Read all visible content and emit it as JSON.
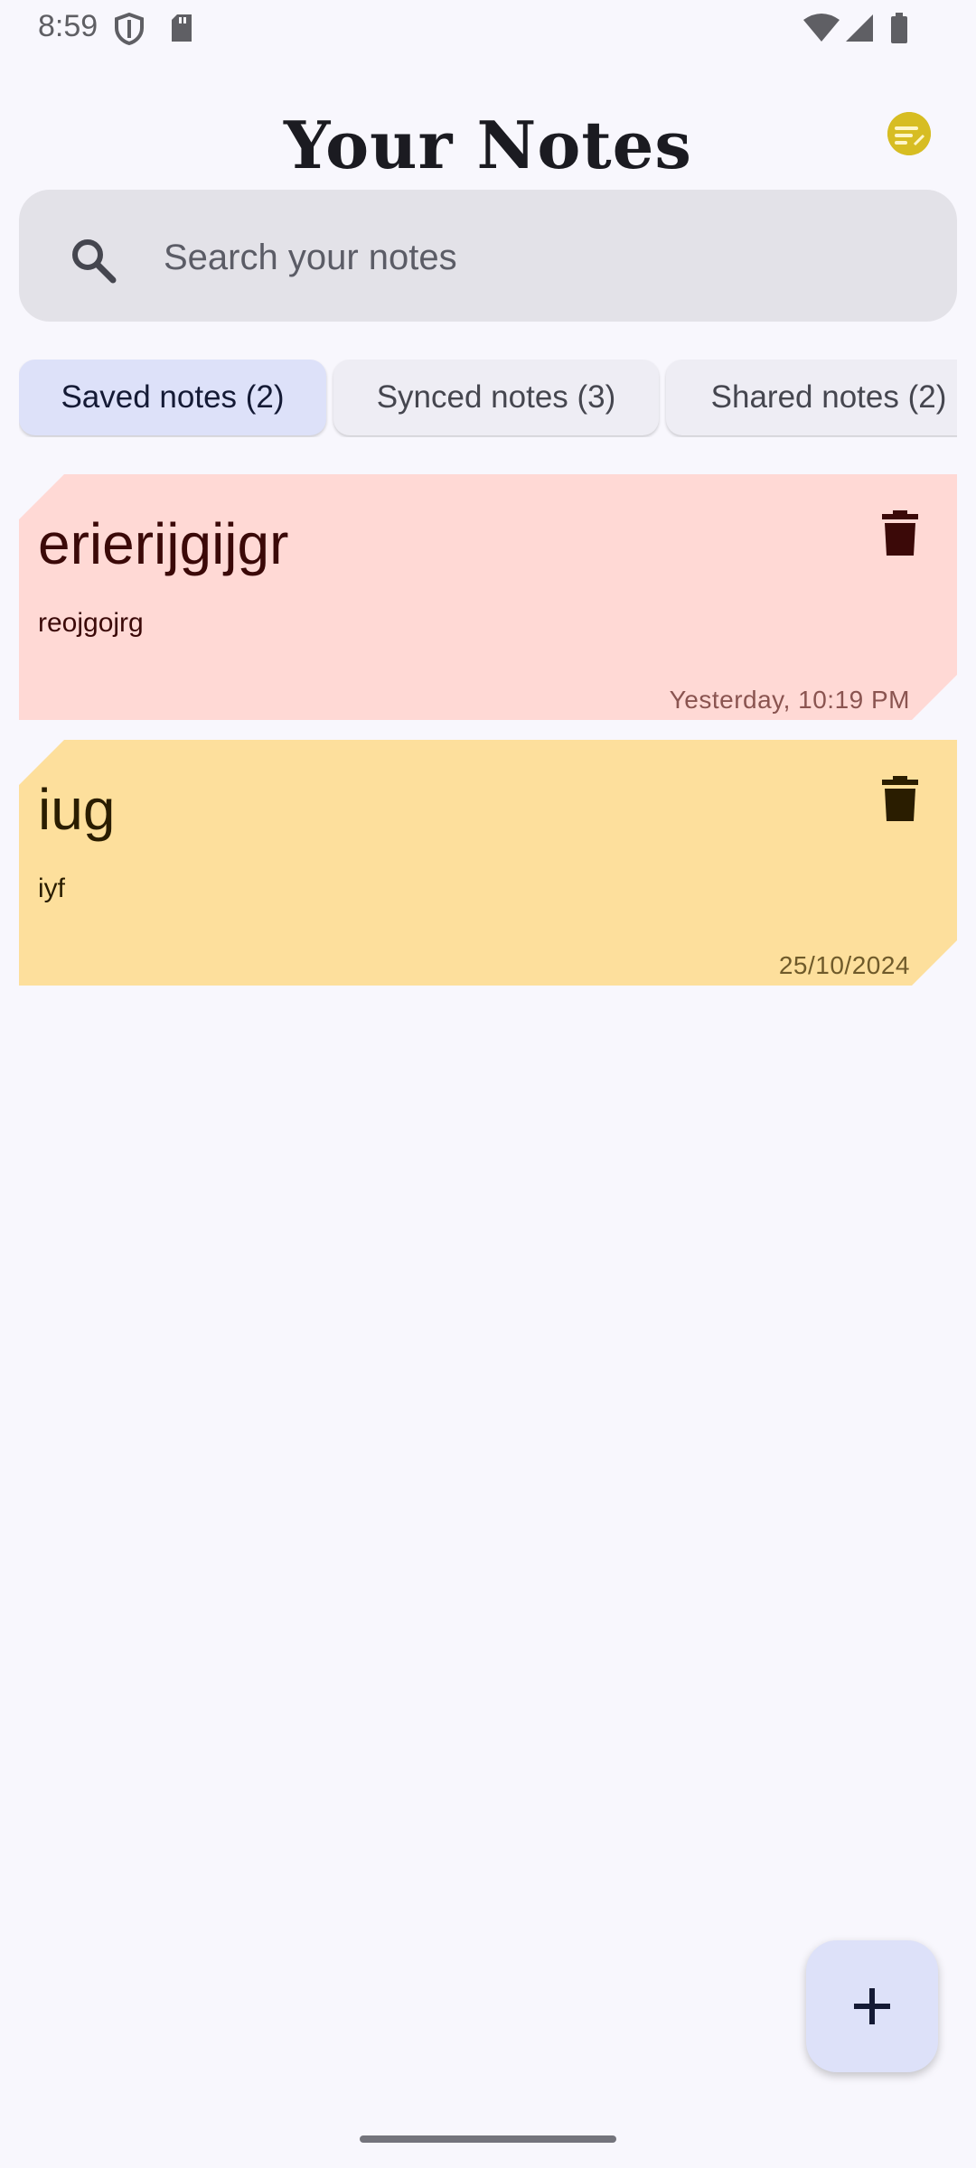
{
  "status_bar": {
    "time": "8:59"
  },
  "header": {
    "title": "Your Notes",
    "logo_text": "Notes"
  },
  "search": {
    "placeholder": "Search your notes",
    "value": ""
  },
  "tabs": [
    {
      "label": "Saved notes (2)",
      "active": true
    },
    {
      "label": "Synced notes (3)",
      "active": false
    },
    {
      "label": "Shared notes (2)",
      "active": false
    }
  ],
  "notes": [
    {
      "title": "erierijgijgr",
      "body": "reojgojrg",
      "date": "Yesterday, 10:19 PM",
      "background": "#ffd9d5",
      "title_color": "#3b0908",
      "date_color": "#8a5450",
      "icon_color": "#3b0908"
    },
    {
      "title": "iug",
      "body": "iyf",
      "date": "25/10/2024",
      "background": "#fddf9c",
      "title_color": "#2a1d00",
      "date_color": "#6f5a2a",
      "icon_color": "#2a1d00"
    }
  ],
  "colors": {
    "background": "#f8f7fd",
    "accent": "#dde1f9",
    "search_bg": "#e3e2e8"
  }
}
